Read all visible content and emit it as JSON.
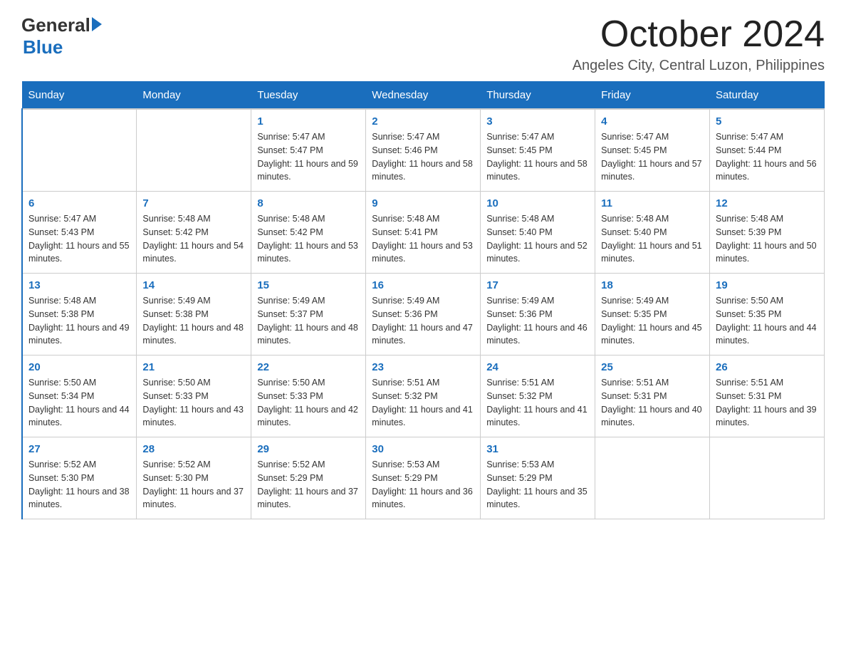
{
  "logo": {
    "general": "General",
    "blue": "Blue"
  },
  "title": {
    "month": "October 2024",
    "location": "Angeles City, Central Luzon, Philippines"
  },
  "weekdays": [
    "Sunday",
    "Monday",
    "Tuesday",
    "Wednesday",
    "Thursday",
    "Friday",
    "Saturday"
  ],
  "weeks": [
    [
      {
        "day": "",
        "sunrise": "",
        "sunset": "",
        "daylight": ""
      },
      {
        "day": "",
        "sunrise": "",
        "sunset": "",
        "daylight": ""
      },
      {
        "day": "1",
        "sunrise": "Sunrise: 5:47 AM",
        "sunset": "Sunset: 5:47 PM",
        "daylight": "Daylight: 11 hours and 59 minutes."
      },
      {
        "day": "2",
        "sunrise": "Sunrise: 5:47 AM",
        "sunset": "Sunset: 5:46 PM",
        "daylight": "Daylight: 11 hours and 58 minutes."
      },
      {
        "day": "3",
        "sunrise": "Sunrise: 5:47 AM",
        "sunset": "Sunset: 5:45 PM",
        "daylight": "Daylight: 11 hours and 58 minutes."
      },
      {
        "day": "4",
        "sunrise": "Sunrise: 5:47 AM",
        "sunset": "Sunset: 5:45 PM",
        "daylight": "Daylight: 11 hours and 57 minutes."
      },
      {
        "day": "5",
        "sunrise": "Sunrise: 5:47 AM",
        "sunset": "Sunset: 5:44 PM",
        "daylight": "Daylight: 11 hours and 56 minutes."
      }
    ],
    [
      {
        "day": "6",
        "sunrise": "Sunrise: 5:47 AM",
        "sunset": "Sunset: 5:43 PM",
        "daylight": "Daylight: 11 hours and 55 minutes."
      },
      {
        "day": "7",
        "sunrise": "Sunrise: 5:48 AM",
        "sunset": "Sunset: 5:42 PM",
        "daylight": "Daylight: 11 hours and 54 minutes."
      },
      {
        "day": "8",
        "sunrise": "Sunrise: 5:48 AM",
        "sunset": "Sunset: 5:42 PM",
        "daylight": "Daylight: 11 hours and 53 minutes."
      },
      {
        "day": "9",
        "sunrise": "Sunrise: 5:48 AM",
        "sunset": "Sunset: 5:41 PM",
        "daylight": "Daylight: 11 hours and 53 minutes."
      },
      {
        "day": "10",
        "sunrise": "Sunrise: 5:48 AM",
        "sunset": "Sunset: 5:40 PM",
        "daylight": "Daylight: 11 hours and 52 minutes."
      },
      {
        "day": "11",
        "sunrise": "Sunrise: 5:48 AM",
        "sunset": "Sunset: 5:40 PM",
        "daylight": "Daylight: 11 hours and 51 minutes."
      },
      {
        "day": "12",
        "sunrise": "Sunrise: 5:48 AM",
        "sunset": "Sunset: 5:39 PM",
        "daylight": "Daylight: 11 hours and 50 minutes."
      }
    ],
    [
      {
        "day": "13",
        "sunrise": "Sunrise: 5:48 AM",
        "sunset": "Sunset: 5:38 PM",
        "daylight": "Daylight: 11 hours and 49 minutes."
      },
      {
        "day": "14",
        "sunrise": "Sunrise: 5:49 AM",
        "sunset": "Sunset: 5:38 PM",
        "daylight": "Daylight: 11 hours and 48 minutes."
      },
      {
        "day": "15",
        "sunrise": "Sunrise: 5:49 AM",
        "sunset": "Sunset: 5:37 PM",
        "daylight": "Daylight: 11 hours and 48 minutes."
      },
      {
        "day": "16",
        "sunrise": "Sunrise: 5:49 AM",
        "sunset": "Sunset: 5:36 PM",
        "daylight": "Daylight: 11 hours and 47 minutes."
      },
      {
        "day": "17",
        "sunrise": "Sunrise: 5:49 AM",
        "sunset": "Sunset: 5:36 PM",
        "daylight": "Daylight: 11 hours and 46 minutes."
      },
      {
        "day": "18",
        "sunrise": "Sunrise: 5:49 AM",
        "sunset": "Sunset: 5:35 PM",
        "daylight": "Daylight: 11 hours and 45 minutes."
      },
      {
        "day": "19",
        "sunrise": "Sunrise: 5:50 AM",
        "sunset": "Sunset: 5:35 PM",
        "daylight": "Daylight: 11 hours and 44 minutes."
      }
    ],
    [
      {
        "day": "20",
        "sunrise": "Sunrise: 5:50 AM",
        "sunset": "Sunset: 5:34 PM",
        "daylight": "Daylight: 11 hours and 44 minutes."
      },
      {
        "day": "21",
        "sunrise": "Sunrise: 5:50 AM",
        "sunset": "Sunset: 5:33 PM",
        "daylight": "Daylight: 11 hours and 43 minutes."
      },
      {
        "day": "22",
        "sunrise": "Sunrise: 5:50 AM",
        "sunset": "Sunset: 5:33 PM",
        "daylight": "Daylight: 11 hours and 42 minutes."
      },
      {
        "day": "23",
        "sunrise": "Sunrise: 5:51 AM",
        "sunset": "Sunset: 5:32 PM",
        "daylight": "Daylight: 11 hours and 41 minutes."
      },
      {
        "day": "24",
        "sunrise": "Sunrise: 5:51 AM",
        "sunset": "Sunset: 5:32 PM",
        "daylight": "Daylight: 11 hours and 41 minutes."
      },
      {
        "day": "25",
        "sunrise": "Sunrise: 5:51 AM",
        "sunset": "Sunset: 5:31 PM",
        "daylight": "Daylight: 11 hours and 40 minutes."
      },
      {
        "day": "26",
        "sunrise": "Sunrise: 5:51 AM",
        "sunset": "Sunset: 5:31 PM",
        "daylight": "Daylight: 11 hours and 39 minutes."
      }
    ],
    [
      {
        "day": "27",
        "sunrise": "Sunrise: 5:52 AM",
        "sunset": "Sunset: 5:30 PM",
        "daylight": "Daylight: 11 hours and 38 minutes."
      },
      {
        "day": "28",
        "sunrise": "Sunrise: 5:52 AM",
        "sunset": "Sunset: 5:30 PM",
        "daylight": "Daylight: 11 hours and 37 minutes."
      },
      {
        "day": "29",
        "sunrise": "Sunrise: 5:52 AM",
        "sunset": "Sunset: 5:29 PM",
        "daylight": "Daylight: 11 hours and 37 minutes."
      },
      {
        "day": "30",
        "sunrise": "Sunrise: 5:53 AM",
        "sunset": "Sunset: 5:29 PM",
        "daylight": "Daylight: 11 hours and 36 minutes."
      },
      {
        "day": "31",
        "sunrise": "Sunrise: 5:53 AM",
        "sunset": "Sunset: 5:29 PM",
        "daylight": "Daylight: 11 hours and 35 minutes."
      },
      {
        "day": "",
        "sunrise": "",
        "sunset": "",
        "daylight": ""
      },
      {
        "day": "",
        "sunrise": "",
        "sunset": "",
        "daylight": ""
      }
    ]
  ]
}
